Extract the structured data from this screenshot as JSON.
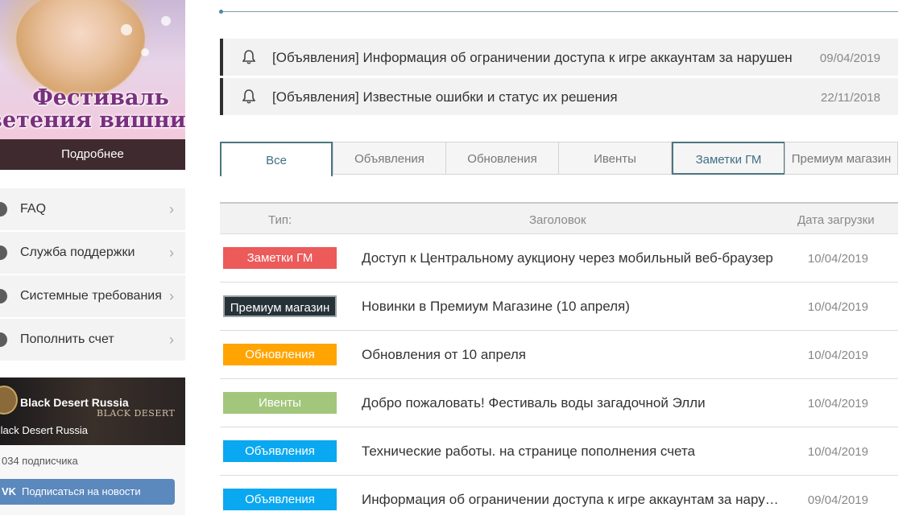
{
  "sidebar": {
    "promo": {
      "title_line1": "Фестиваль",
      "title_line2": "цветения вишни",
      "more_label": "Подробнее"
    },
    "menu": [
      {
        "label": "FAQ",
        "icon": "question-icon"
      },
      {
        "label": "Служба поддержки",
        "icon": "support-icon"
      },
      {
        "label": "Системные требования",
        "icon": "system-icon"
      },
      {
        "label": "Пополнить счет",
        "icon": "wallet-icon"
      }
    ],
    "vk": {
      "group_name": "Black Desert Russia",
      "group_subtitle": "Black Desert Russia",
      "logo_text": "BLACK DESERT",
      "subscribers": "034 подписчика",
      "subscribe_label": "Подписаться на новости",
      "vk_icon": "vk-icon"
    }
  },
  "notices": [
    {
      "title": "[Объявления] Информация об ограничении доступа к игре аккаунтам за нарушен",
      "date": "09/04/2019"
    },
    {
      "title": "[Объявления] Известные ошибки и статус их решения",
      "date": "22/11/2018"
    }
  ],
  "tabs": [
    "Все",
    "Объявления",
    "Обновления",
    "Ивенты",
    "Заметки ГМ",
    "Премиум магазин"
  ],
  "table": {
    "headers": {
      "type": "Тип:",
      "title": "Заголовок",
      "date": "Дата загрузки"
    },
    "rows": [
      {
        "tag": "Заметки ГМ",
        "tag_color": "#ec5a5a",
        "title": "Доступ к Центральному аукциону через мобильный веб-браузер",
        "date": "10/04/2019"
      },
      {
        "tag": "Премиум магазин",
        "tag_color": "#263238",
        "title": "Новинки в Премиум Магазине (10 апреля)",
        "date": "10/04/2019"
      },
      {
        "tag": "Обновления",
        "tag_color": "#ffa400",
        "title": "Обновления от 10 апреля",
        "date": "10/04/2019"
      },
      {
        "tag": "Ивенты",
        "tag_color": "#a3c67d",
        "title": "Добро пожаловать! Фестиваль воды загадочной Элли",
        "date": "10/04/2019"
      },
      {
        "tag": "Объявления",
        "tag_color": "#0aa8f0",
        "title": "Технические работы. на странице пополнения счета",
        "date": "10/04/2019"
      },
      {
        "tag": "Объявления",
        "tag_color": "#0aa8f0",
        "title": "Информация об ограничении доступа к игре аккаунтам за нарушения",
        "date": "09/04/2019"
      }
    ]
  }
}
